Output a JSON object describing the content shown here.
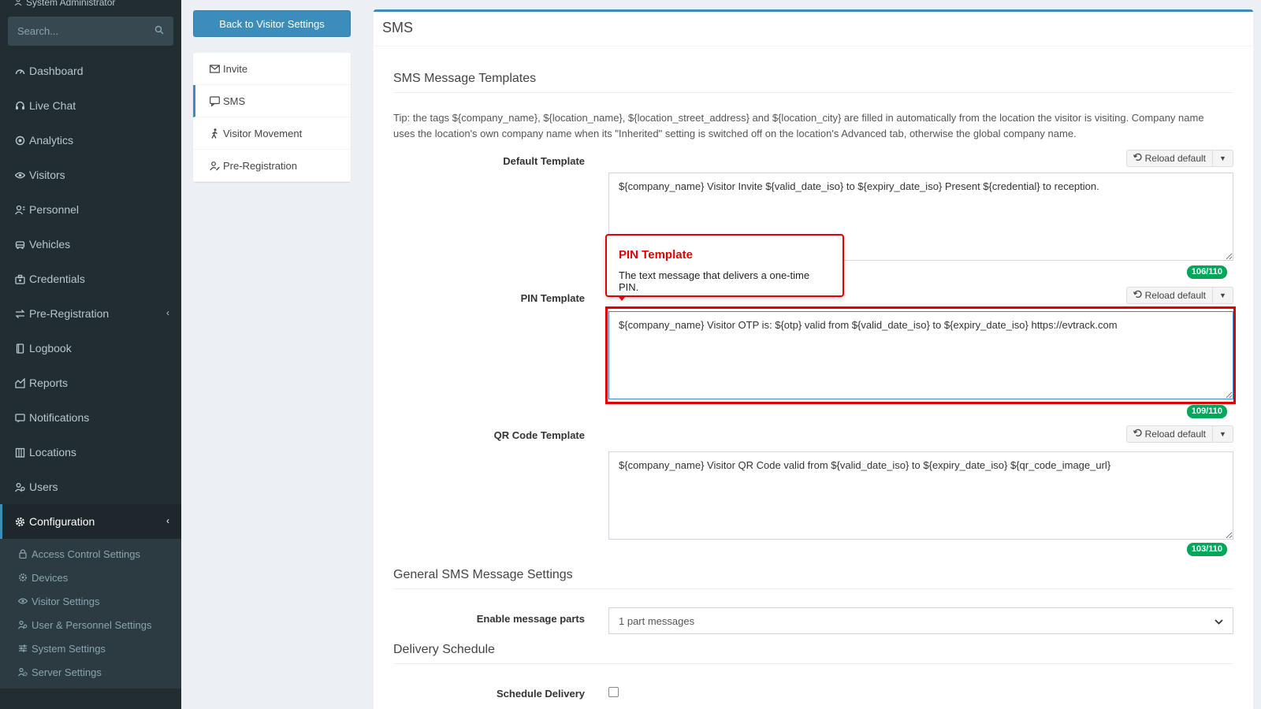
{
  "sidebar": {
    "user_role": "System Administrator",
    "search_placeholder": "Search...",
    "items": [
      {
        "label": "Dashboard"
      },
      {
        "label": "Live Chat"
      },
      {
        "label": "Analytics"
      },
      {
        "label": "Visitors"
      },
      {
        "label": "Personnel"
      },
      {
        "label": "Vehicles"
      },
      {
        "label": "Credentials"
      },
      {
        "label": "Pre-Registration"
      },
      {
        "label": "Logbook"
      },
      {
        "label": "Reports"
      },
      {
        "label": "Notifications"
      },
      {
        "label": "Locations"
      },
      {
        "label": "Users"
      },
      {
        "label": "Configuration"
      }
    ],
    "sub_items": [
      {
        "label": "Access Control Settings"
      },
      {
        "label": "Devices"
      },
      {
        "label": "Visitor Settings"
      },
      {
        "label": "User & Personnel Settings"
      },
      {
        "label": "System Settings"
      },
      {
        "label": "Server Settings"
      }
    ]
  },
  "subnav": {
    "back_label": "Back to Visitor Settings",
    "items": [
      {
        "label": "Invite"
      },
      {
        "label": "SMS"
      },
      {
        "label": "Visitor Movement"
      },
      {
        "label": "Pre-Registration"
      }
    ]
  },
  "main": {
    "header": "SMS",
    "templates_title": "SMS Message Templates",
    "tip": "Tip: the tags ${company_name}, ${location_name}, ${location_street_address} and ${location_city} are filled in automatically from the location the visitor is visiting. Company name uses the location's own company name when its \"Inherited\" setting is switched off on the location's Advanced tab, otherwise the global company name.",
    "reload_label": "Reload default",
    "default_template": {
      "label": "Default Template",
      "value": "${company_name} Visitor Invite ${valid_date_iso} to ${expiry_date_iso} Present ${credential} to reception.",
      "count": "106/110"
    },
    "pin_template": {
      "label": "PIN Template",
      "value": "${company_name} Visitor OTP is: ${otp} valid from ${valid_date_iso} to ${expiry_date_iso} https://evtrack.com",
      "count": "109/110"
    },
    "qr_template": {
      "label": "QR Code Template",
      "value": "${company_name} Visitor QR Code valid from ${valid_date_iso} to ${expiry_date_iso} ${qr_code_image_url}",
      "count": "103/110"
    },
    "general_title": "General SMS Message Settings",
    "message_parts": {
      "label": "Enable message parts",
      "value": "1 part messages"
    },
    "delivery_title": "Delivery Schedule",
    "schedule_label": "Schedule Delivery"
  },
  "tooltip": {
    "title": "PIN Template",
    "body": "The text message that delivers a one-time PIN."
  }
}
